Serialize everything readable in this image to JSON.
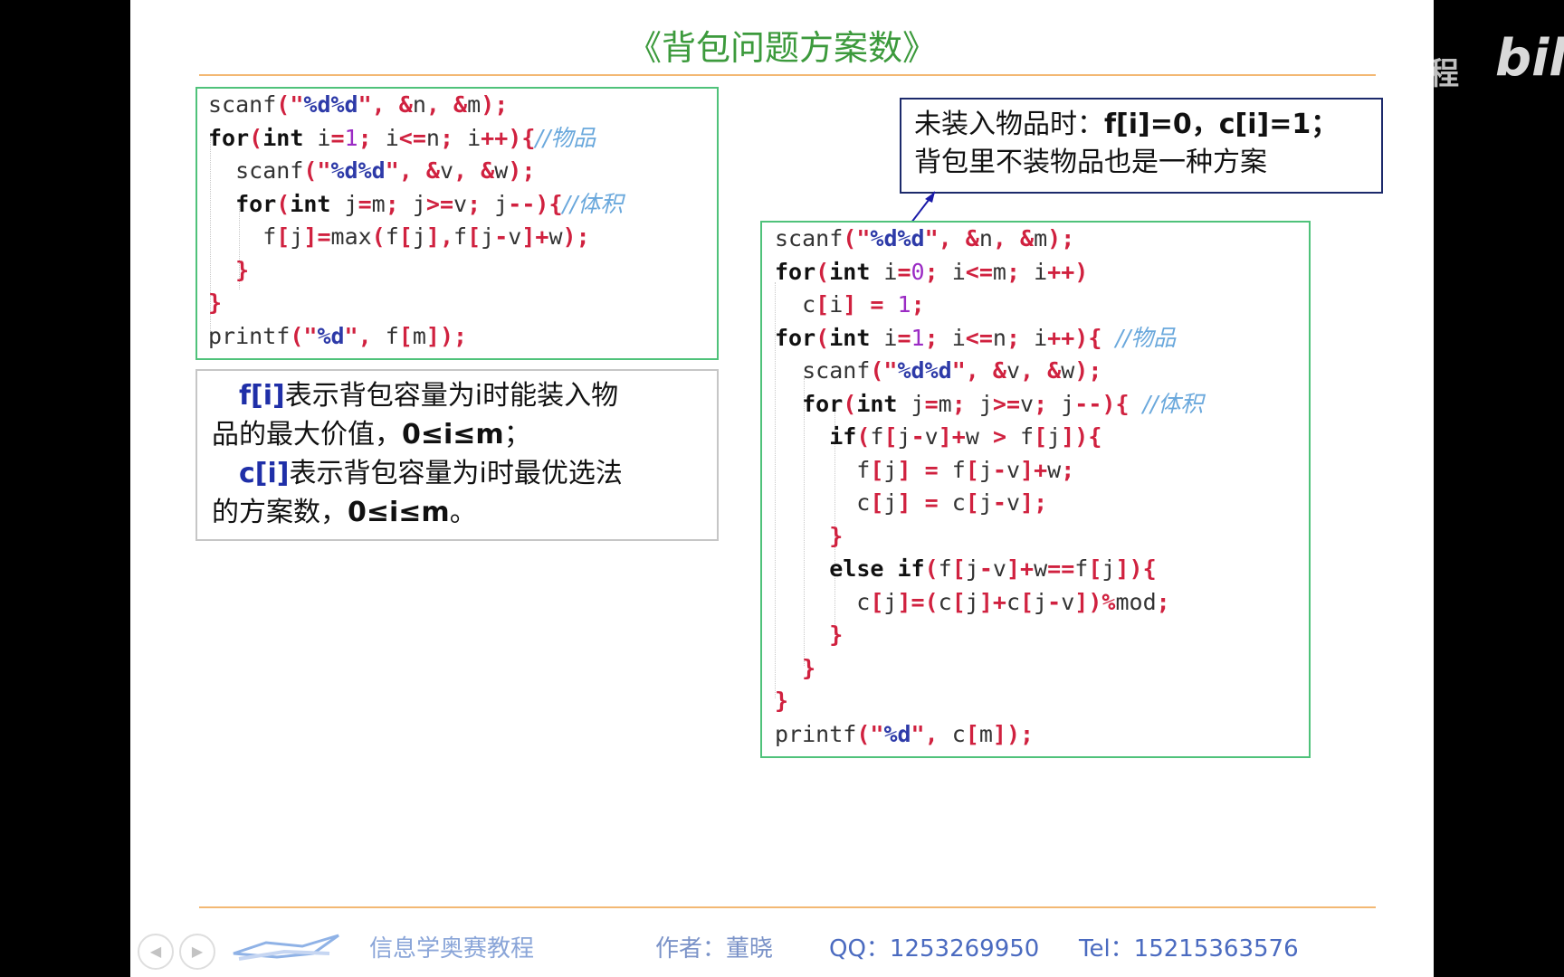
{
  "slide": {
    "title": "《背包问题方案数》"
  },
  "code_left": [
    [
      "scanf(\"%d%d\", &n, &m);"
    ],
    [
      "for(int i=1; i<=n; i++){//物品"
    ],
    [
      "  scanf(\"%d%d\", &v, &w);"
    ],
    [
      "  for(int j=m; j>=v; j--){//体积"
    ],
    [
      "    f[j]=max(f[j],f[j-v]+w);"
    ],
    [
      "  }"
    ],
    [
      "}"
    ],
    [
      "printf(\"%d\", f[m]);"
    ]
  ],
  "description": {
    "line1_var": "f[i]",
    "line1_text": "表示背包容量为i时能装入物",
    "line2_text": "品的最大价值，",
    "line2_range": "0≤i≤m",
    "line2_end": "；",
    "line3_var": "c[i]",
    "line3_text": "表示背包容量为i时最优选法",
    "line4_text": "的方案数，",
    "line4_range": "0≤i≤m",
    "line4_end": "。"
  },
  "callout": {
    "line1_text": "未装入物品时：",
    "line1_code": "f[i]=0，c[i]=1；",
    "line2_text": "背包里不装物品也是一种方案"
  },
  "code_right": [
    "scanf(\"%d%d\", &n, &m);",
    "for(int i=0; i<=m; i++)",
    "  c[i] = 1;",
    "for(int i=1; i<=n; i++){ //物品",
    "  scanf(\"%d%d\", &v, &w);",
    "  for(int j=m; j>=v; j--){ //体积",
    "    if(f[j-v]+w > f[j]){",
    "      f[j] = f[j-v]+w;",
    "      c[j] = c[j-v];",
    "    }",
    "    else if(f[j-v]+w==f[j]){",
    "      c[j]=(c[j]+c[j-v])%mod;",
    "    }",
    "  }",
    "}",
    "printf(\"%d\", c[m]);"
  ],
  "footer": {
    "course": "信息学奥赛教程",
    "author": "作者：董晓",
    "qq": "QQ：1253269950",
    "tel": "Tel：15215363576"
  },
  "watermark": {
    "text1": "编程",
    "text2": "bili"
  },
  "colors": {
    "title": "#3c9a3c",
    "code_border": "#4fc27a",
    "keyword_red": "#d0213f",
    "string_blue": "#2d3aa8",
    "comment": "#6aa8dc",
    "callout_border": "#1c2a6b",
    "rule": "#f3b873"
  }
}
